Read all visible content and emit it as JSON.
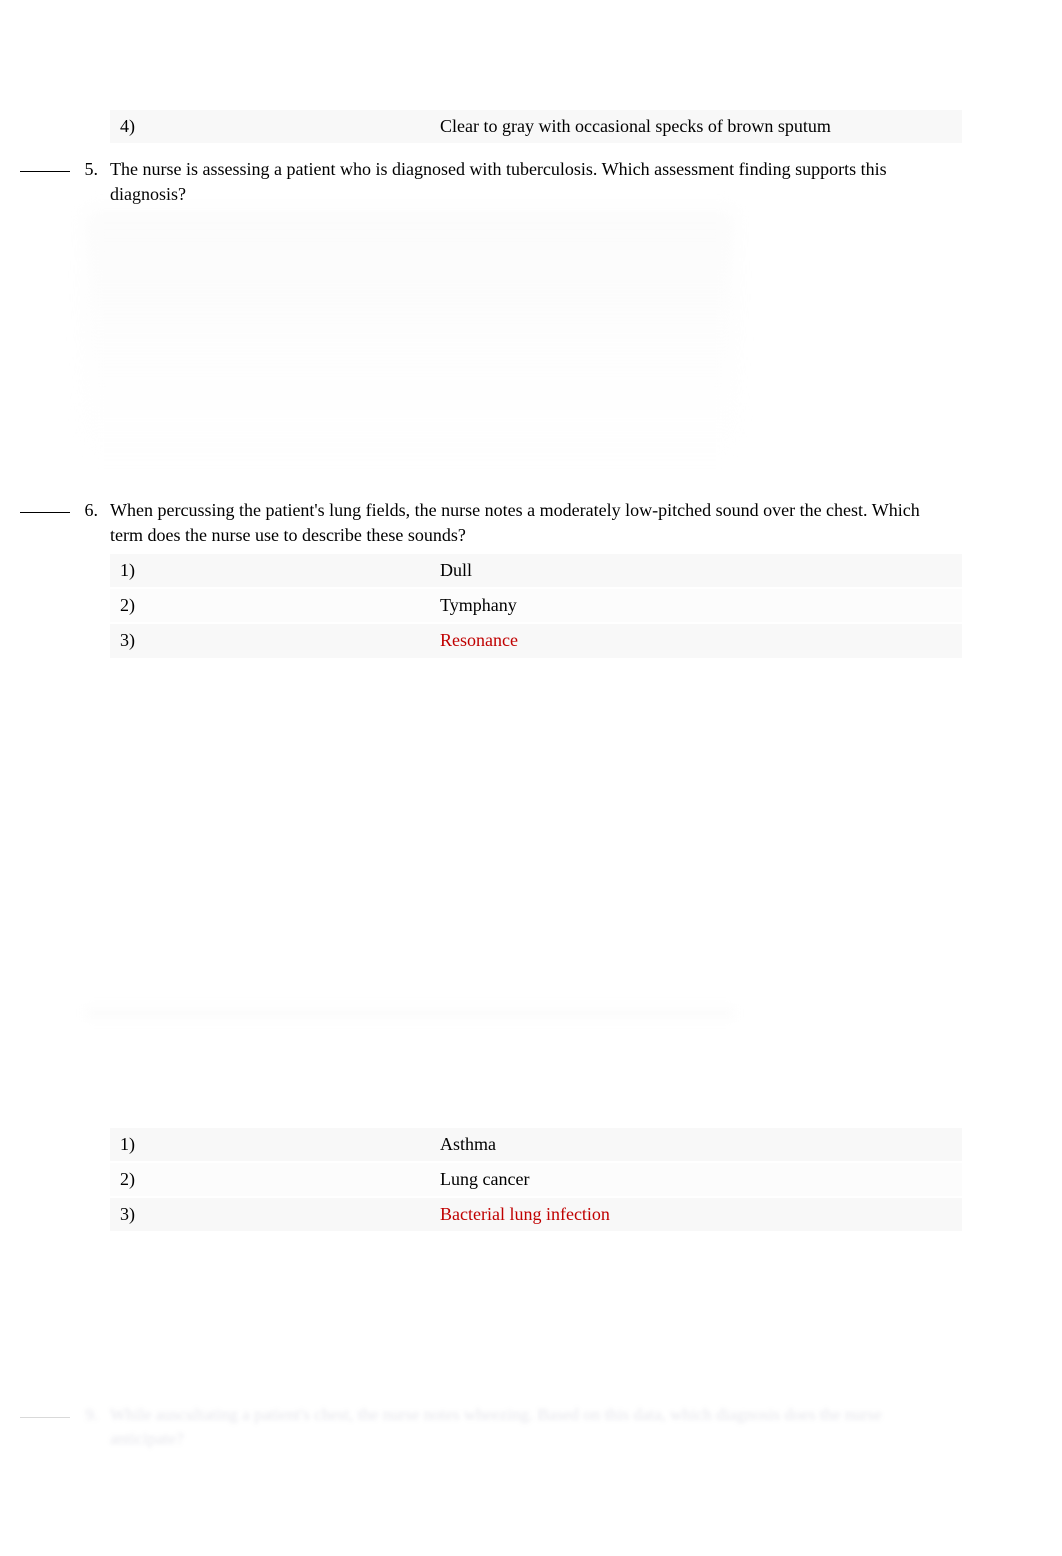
{
  "q4_option": {
    "number": "4)",
    "text": "Clear to gray with occasional specks of brown sputum"
  },
  "q5": {
    "number": "5.",
    "text": "The nurse is assessing a patient who is diagnosed with tuberculosis. Which assessment finding supports this diagnosis?"
  },
  "q6": {
    "number": "6.",
    "text": "When percussing the patient's lung fields, the nurse notes a moderately low-pitched sound over the chest. Which term does the nurse use to describe these sounds?",
    "options": [
      {
        "number": "1)",
        "text": "Dull",
        "highlight": false
      },
      {
        "number": "2)",
        "text": "Tymphany",
        "highlight": false
      },
      {
        "number": "3)",
        "text": "Resonance",
        "highlight": true
      }
    ]
  },
  "q8_options": [
    {
      "number": "1)",
      "text": "Asthma",
      "highlight": false
    },
    {
      "number": "2)",
      "text": "Lung cancer",
      "highlight": false
    },
    {
      "number": "3)",
      "text": "Bacterial lung infection",
      "highlight": true
    }
  ],
  "q9": {
    "number": "9.",
    "text": "While auscultating a patient's chest, the nurse notes wheezing. Based on this data, which diagnosis does the nurse anticipate?"
  }
}
